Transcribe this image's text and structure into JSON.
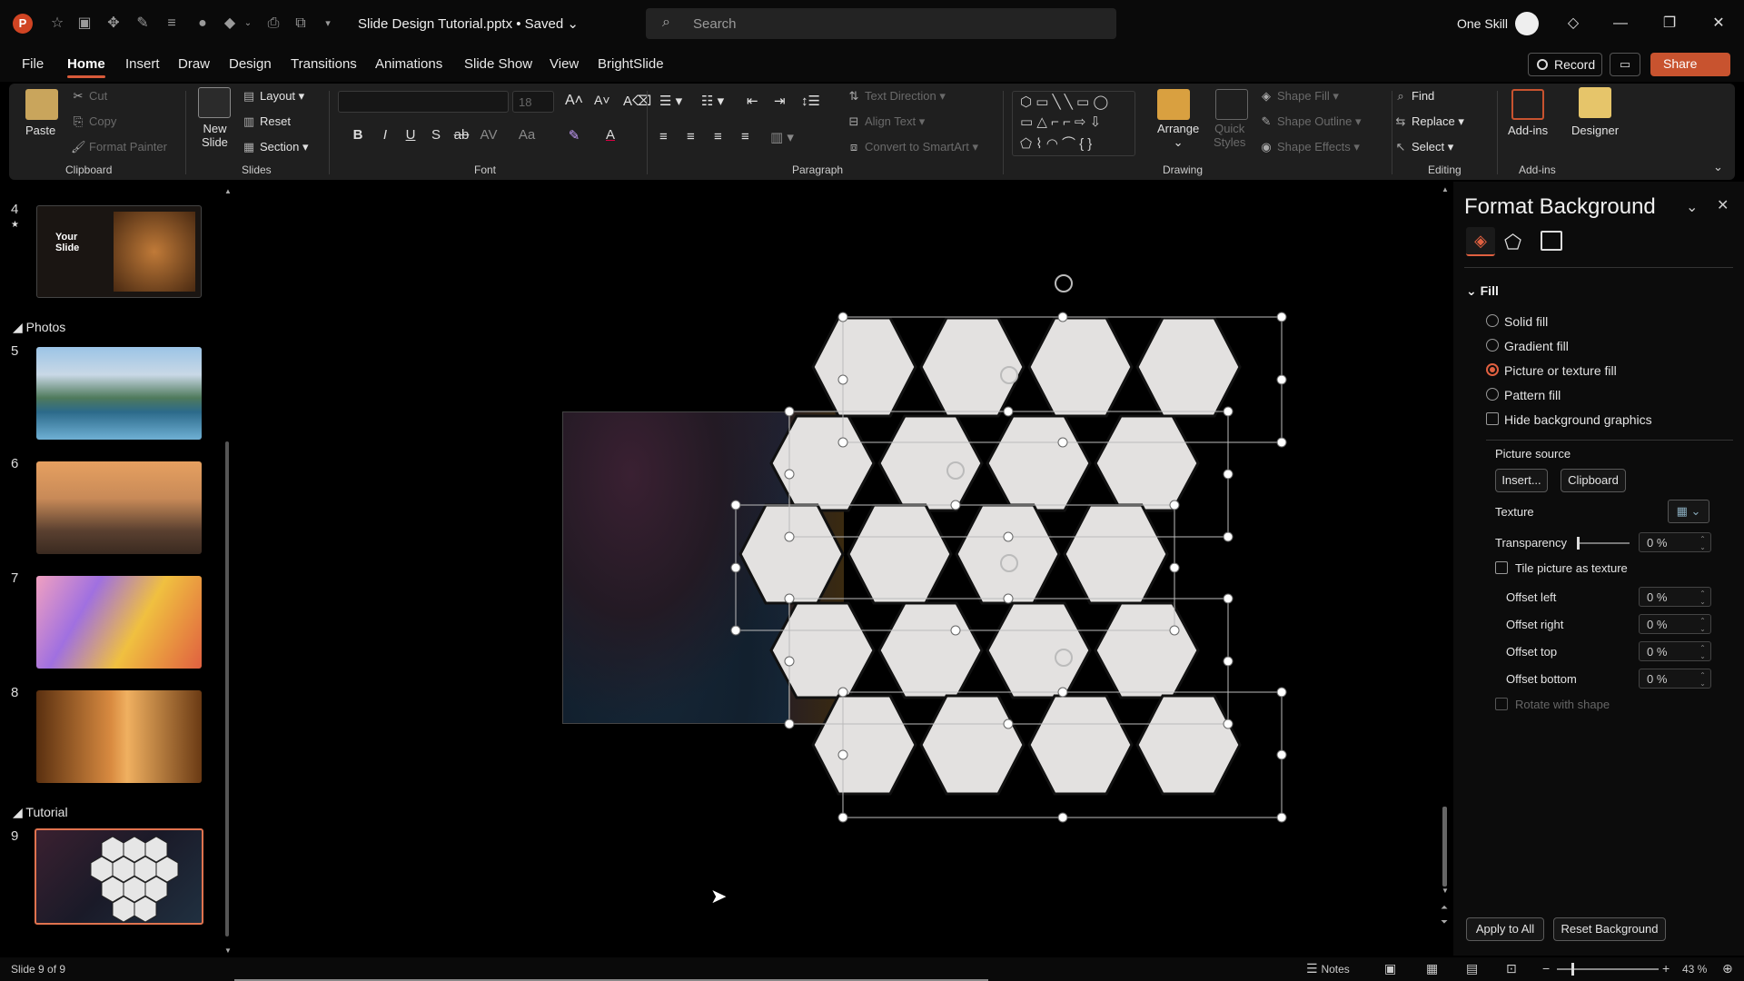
{
  "titlebar": {
    "app_logo": "P",
    "document_title": "Slide Design Tutorial.pptx • Saved ⌄",
    "search_placeholder": "Search",
    "account_name": "One Skill",
    "quick_access_icons": [
      "autosave-icon",
      "present-icon",
      "touch-mode-icon",
      "draw-icon",
      "format-icon",
      "record-icon",
      "shape-icon",
      "dropdown-icon",
      "print-icon",
      "arrange-icon",
      "customize-icon"
    ]
  },
  "menu": {
    "tabs": [
      "File",
      "Home",
      "Insert",
      "Draw",
      "Design",
      "Transitions",
      "Animations",
      "Slide Show",
      "View",
      "BrightSlide"
    ],
    "active_tab": "Home",
    "record_label": "Record",
    "share_label": "Share"
  },
  "ribbon": {
    "clipboard": {
      "paste": "Paste",
      "cut": "Cut",
      "copy": "Copy",
      "format_painter": "Format Painter",
      "label": "Clipboard"
    },
    "slides": {
      "new_slide_line1": "New",
      "new_slide_line2": "Slide",
      "layout": "Layout",
      "reset": "Reset",
      "section": "Section",
      "label": "Slides"
    },
    "font": {
      "font_size": "18",
      "label": "Font",
      "buttons": [
        "B",
        "I",
        "U",
        "S",
        "ab",
        "AV",
        "Aa"
      ]
    },
    "paragraph": {
      "text_direction": "Text Direction",
      "align_text": "Align Text",
      "convert_smartart": "Convert to SmartArt",
      "label": "Paragraph"
    },
    "drawing": {
      "arrange": "Arrange",
      "quick_styles_line1": "Quick",
      "quick_styles_line2": "Styles",
      "shape_fill": "Shape Fill",
      "shape_outline": "Shape Outline",
      "shape_effects": "Shape Effects",
      "label": "Drawing"
    },
    "editing": {
      "find": "Find",
      "replace": "Replace",
      "select": "Select",
      "label": "Editing"
    },
    "addins": {
      "addins": "Add-ins",
      "designer": "Designer",
      "label": "Add-ins"
    }
  },
  "thumbnails": {
    "sections": [
      {
        "name": "Photos"
      },
      {
        "name": "Tutorial"
      }
    ],
    "slides": [
      {
        "num": "4",
        "text_line1": "Your",
        "text_line2": "Slide"
      },
      {
        "num": "5"
      },
      {
        "num": "6"
      },
      {
        "num": "7"
      },
      {
        "num": "8"
      },
      {
        "num": "9"
      }
    ]
  },
  "format_pane": {
    "title": "Format Background",
    "section": "Fill",
    "options": [
      "Solid fill",
      "Gradient fill",
      "Picture or texture fill",
      "Pattern fill"
    ],
    "selected_option": "Picture or texture fill",
    "hide_bg_graphics": "Hide background graphics",
    "picture_source": "Picture source",
    "insert_btn": "Insert...",
    "clipboard_btn": "Clipboard",
    "texture": "Texture",
    "transparency": "Transparency",
    "transparency_value": "0 %",
    "tile_picture": "Tile picture as texture",
    "offset_left": "Offset left",
    "offset_left_value": "0 %",
    "offset_right": "Offset right",
    "offset_right_value": "0 %",
    "offset_top": "Offset top",
    "offset_top_value": "0 %",
    "offset_bottom": "Offset bottom",
    "offset_bottom_value": "0 %",
    "rotate_with_shape": "Rotate with shape",
    "apply_all": "Apply to All",
    "reset_background": "Reset Background"
  },
  "statusbar": {
    "slide_info": "Slide 9 of 9",
    "notes": "Notes",
    "zoom": "43 %"
  },
  "colors": {
    "accent": "#c8532f",
    "hex_fill": "#e6e6e6",
    "ribbon_bg": "#1f1f1f"
  }
}
